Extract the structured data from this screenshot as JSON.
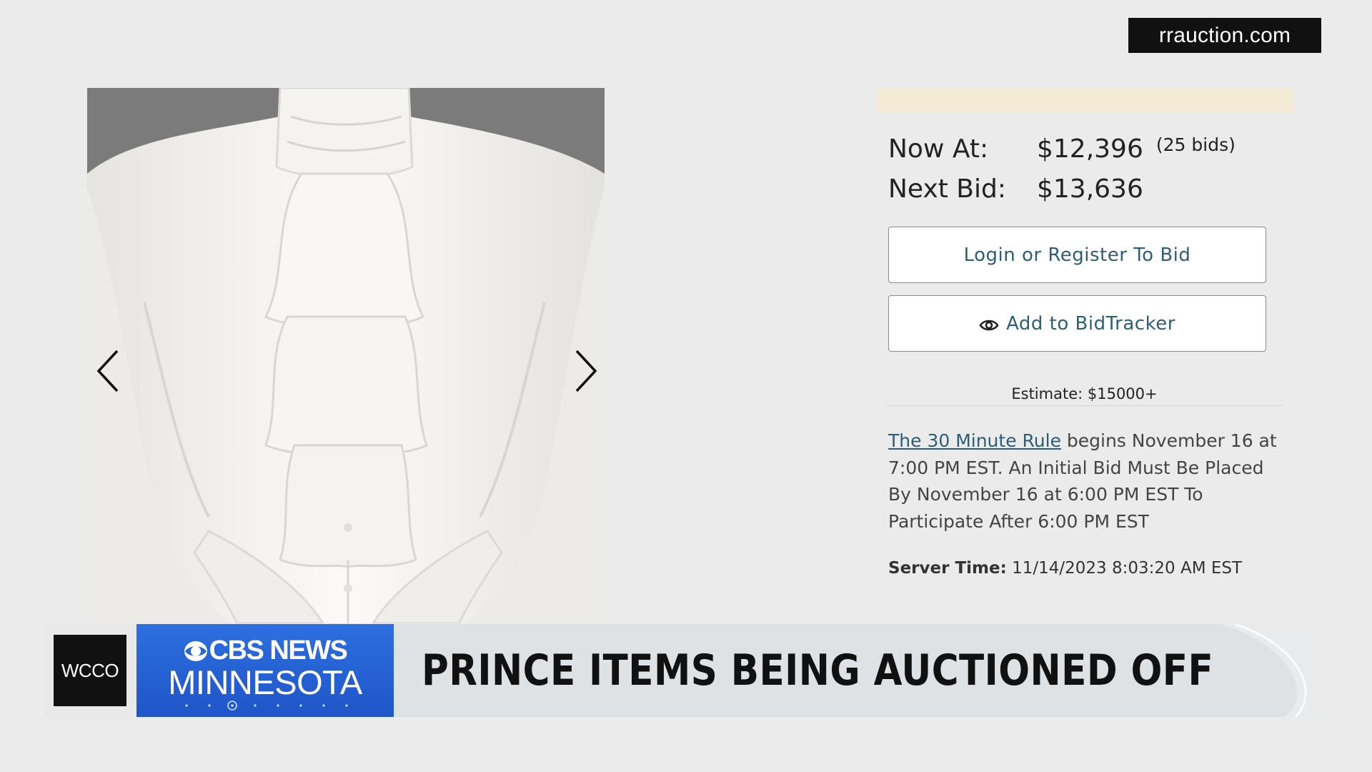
{
  "source_tag": "rrauction.com",
  "listing": {
    "now_at_label": "Now At:",
    "now_at_value": "$12,396",
    "bid_count": "(25 bids)",
    "next_bid_label": "Next Bid:",
    "next_bid_value": "$13,636",
    "login_button_label": "Login or Register To Bid",
    "bidtracker_button_label": "Add to BidTracker",
    "estimate": "Estimate: $15000+",
    "rule_link_text": "The 30 Minute Rule",
    "rule_text": " begins November 16 at 7:00 PM EST. An Initial Bid Must Be Placed By November 16 at 6:00 PM EST To Participate After 6:00 PM EST",
    "server_time_label": "Server Time:",
    "server_time_value": " 11/14/2023 8:03:20 AM EST"
  },
  "icons": {
    "carousel_prev": "chevron-left-icon",
    "carousel_next": "chevron-right-icon",
    "bidtracker": "eye-icon"
  },
  "lower_third": {
    "station": "WCCO",
    "network_line1": "CBS NEWS",
    "network_line2": "MINNESOTA",
    "headline": "PRINCE ITEMS BEING AUCTIONED OFF"
  },
  "colors": {
    "link": "#2c5e78",
    "network_blue": "#1f55c8",
    "note_strip": "#f3ead5",
    "photo_background": "#7b7b7b"
  }
}
